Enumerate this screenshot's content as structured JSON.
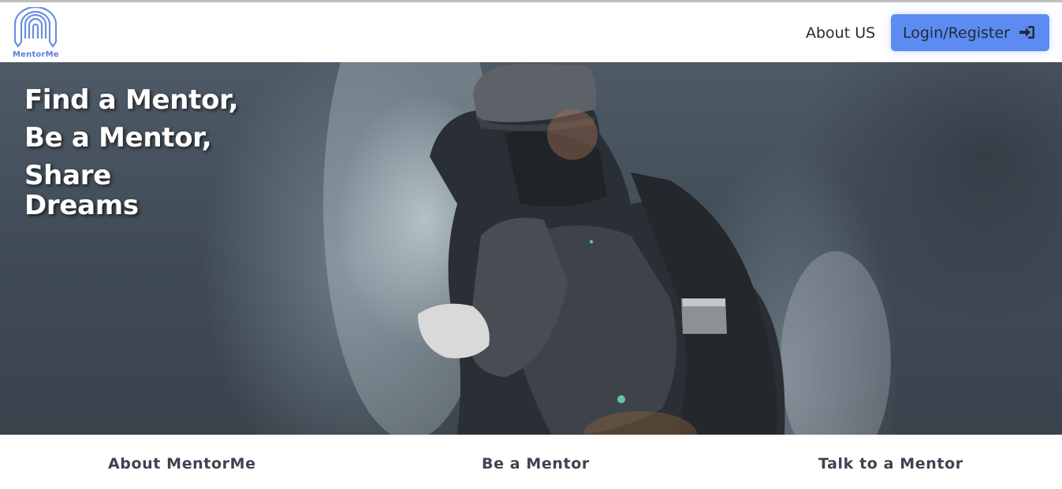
{
  "brand": {
    "name": "MentorMe",
    "logo_icon": "arch-pencils-logo-icon",
    "accent": "#5c8cf2"
  },
  "nav": {
    "about_label": "About US",
    "login_label": "Login/Register",
    "login_icon": "sign-in-icon"
  },
  "hero": {
    "lines": [
      "Find a Mentor,",
      "Be a Mentor,",
      "Share",
      "Dreams"
    ]
  },
  "footer": {
    "links": [
      "About MentorMe",
      "Be a Mentor",
      "Talk to a Mentor"
    ]
  }
}
